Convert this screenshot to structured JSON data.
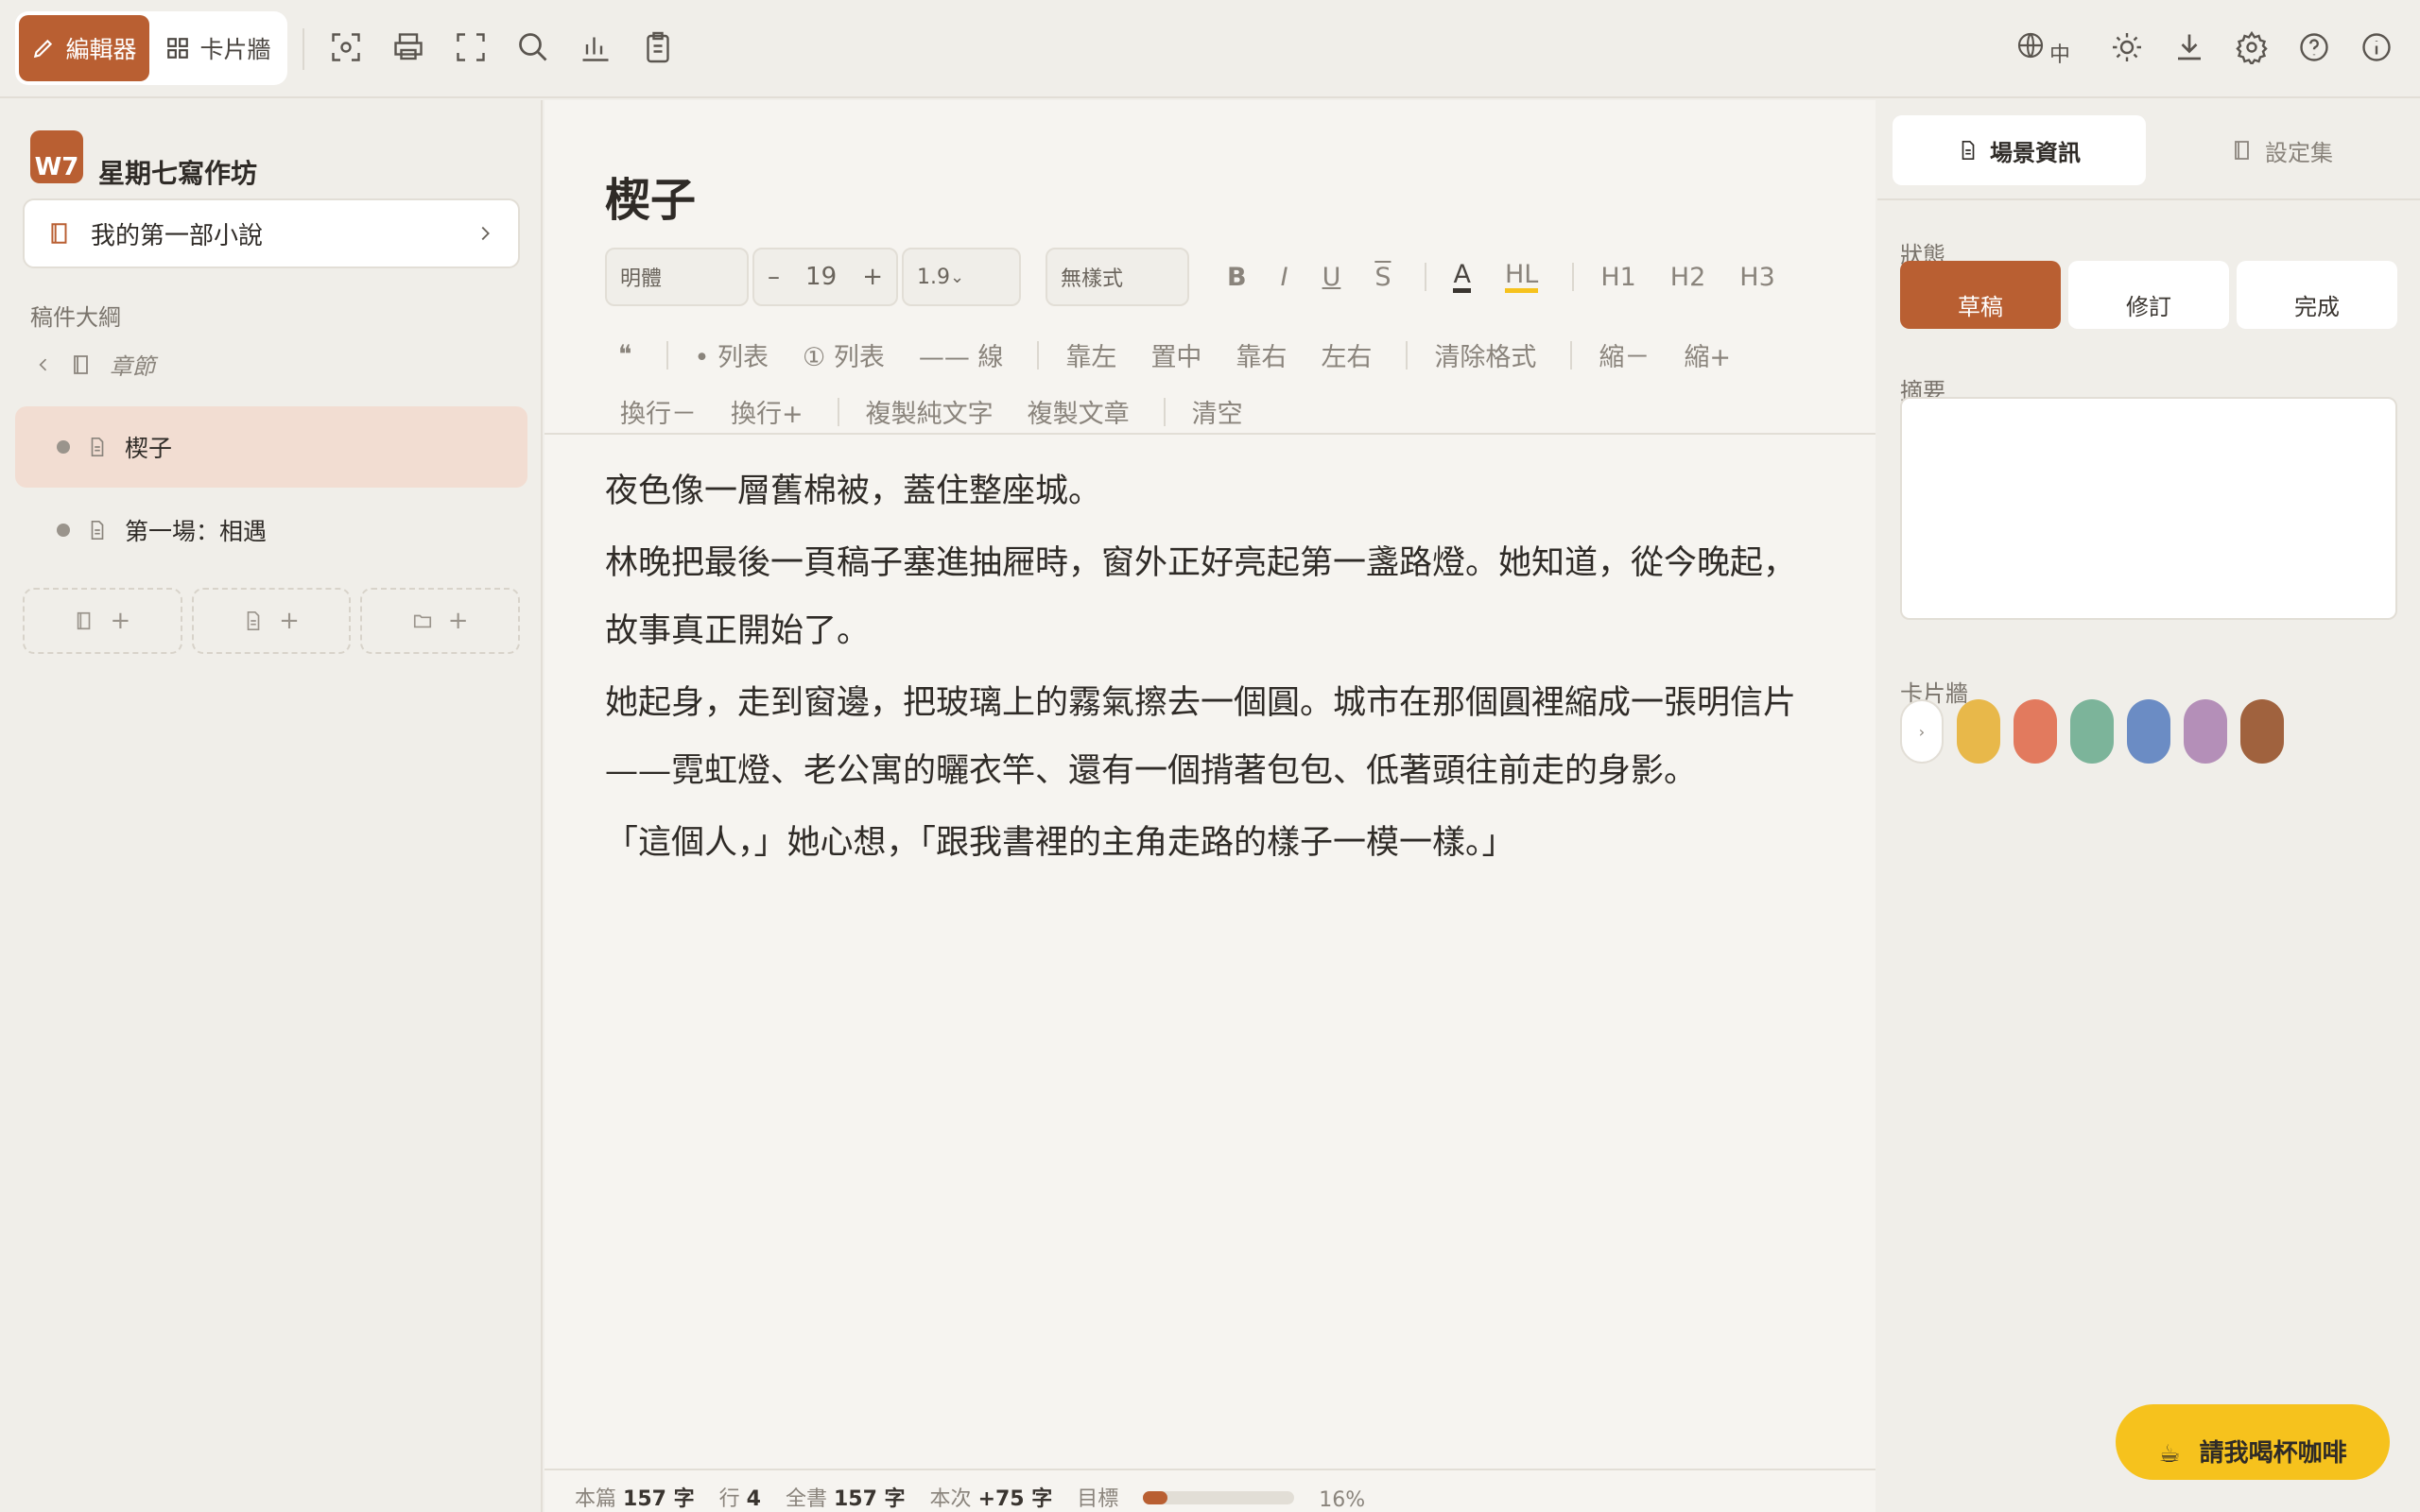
{
  "topbar": {
    "mode_editor": "編輯器",
    "mode_cards": "卡片牆",
    "lang": "中",
    "icons": [
      "focus-icon",
      "print-icon",
      "fullscreen-icon",
      "search-icon",
      "stats-icon",
      "clipboard-icon",
      "globe-icon",
      "sun-icon",
      "download-icon",
      "gear-icon",
      "help-icon",
      "info-icon"
    ]
  },
  "sidebar": {
    "logo": "W7",
    "app_name": "星期七寫作坊",
    "book": "我的第一部小說",
    "outline_title": "稿件大綱",
    "chapter": "章節",
    "scenes": [
      {
        "label": "楔子",
        "active": true
      },
      {
        "label": "第一場：相遇",
        "active": false
      }
    ]
  },
  "editor": {
    "title": "楔子",
    "font": "明體",
    "font_size": "19",
    "line_height": "1.9",
    "style": "無樣式",
    "fmt_row1": [
      "B",
      "I",
      "U",
      "S",
      "A",
      "HL",
      "H1",
      "H2",
      "H3"
    ],
    "fmt_row2": [
      "❝",
      "• 列表",
      "① 列表",
      "—— 線",
      "靠左",
      "置中",
      "靠右",
      "左右",
      "清除格式",
      "縮－",
      "縮+"
    ],
    "fmt_row3": [
      "換行－",
      "換行+",
      "複製純文字",
      "複製文章",
      "清空"
    ],
    "paragraphs": [
      "夜色像一層舊棉被，蓋住整座城。",
      "林晚把最後一頁稿子塞進抽屜時，窗外正好亮起第一盞路燈。她知道，從今晚起，故事真正開始了。",
      "她起身，走到窗邊，把玻璃上的霧氣擦去一個圓。城市在那個圓裡縮成一張明信片——霓虹燈、老公寓的曬衣竿、還有一個揹著包包、低著頭往前走的身影。",
      "「這個人，」她心想，「跟我書裡的主角走路的樣子一模一樣。」"
    ],
    "status": {
      "this_label": "本篇",
      "this_count": "157 字",
      "line_label": "行",
      "line_value": "4",
      "book_label": "全書",
      "book_count": "157 字",
      "session_label": "本次",
      "session_count": "+75 字",
      "goal_label": "目標",
      "goal_progress": 0.16,
      "goal_percent": "16%"
    }
  },
  "panel": {
    "tab_scene": "場景資訊",
    "tab_settings": "設定集",
    "status_label": "狀態",
    "status_options": [
      "草稿",
      "修訂",
      "完成"
    ],
    "status_selected": "草稿",
    "summary_label": "摘要",
    "cardwall_label": "卡片牆",
    "colors": [
      "#e8b84a",
      "#e27a5e",
      "#7cb49a",
      "#6b8cc4",
      "#b48fb8",
      "#a0623e"
    ]
  },
  "coffee": {
    "label": "請我喝杯咖啡",
    "icon": "☕"
  }
}
